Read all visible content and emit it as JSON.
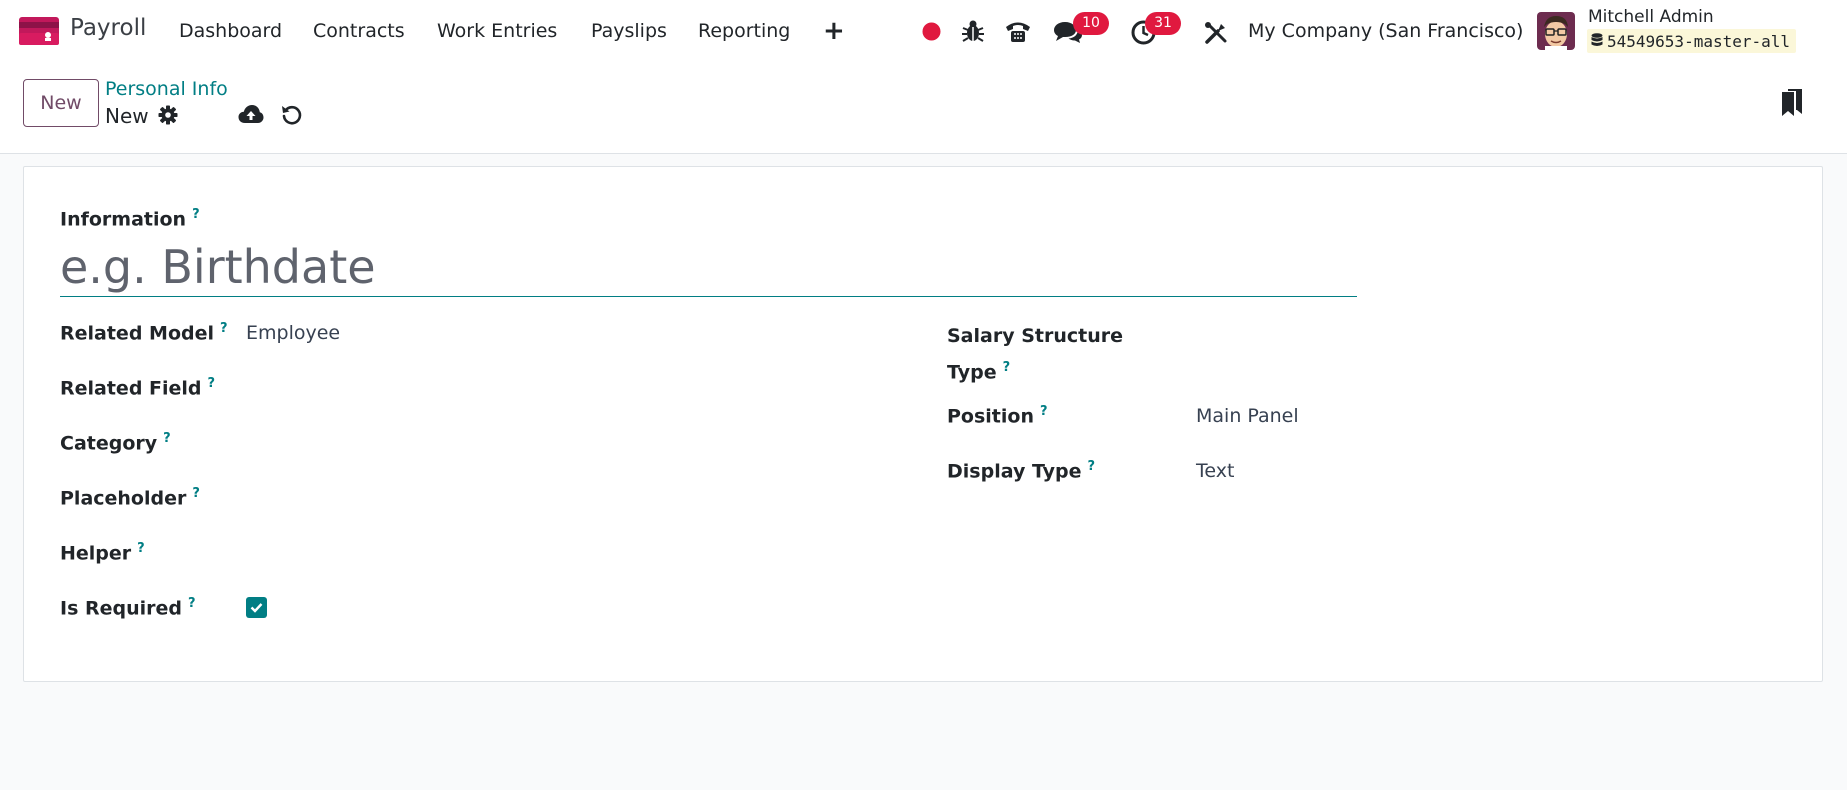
{
  "navbar": {
    "app_name": "Payroll",
    "menu": [
      "Dashboard",
      "Contracts",
      "Work Entries",
      "Payslips",
      "Reporting"
    ],
    "add_symbol": "+",
    "messages_count": "10",
    "activities_count": "31",
    "company": "My Company (San Francisco)",
    "user_name": "Mitchell Admin",
    "database": "54549653-master-all",
    "recording_color": "#e0193f"
  },
  "control_panel": {
    "new_button": "New",
    "breadcrumb_parent": "Personal Info",
    "breadcrumb_current": "New"
  },
  "form": {
    "information_label": "Information",
    "information_placeholder": "e.g. Birthdate",
    "help_mark": "?",
    "left_fields": [
      {
        "label": "Related Model",
        "value": "Employee"
      },
      {
        "label": "Related Field",
        "value": ""
      },
      {
        "label": "Category",
        "value": ""
      },
      {
        "label": "Placeholder",
        "value": ""
      },
      {
        "label": "Helper",
        "value": ""
      },
      {
        "label": "Is Required",
        "checked": true
      }
    ],
    "right_fields": [
      {
        "label_line1": "Salary Structure",
        "label_line2": "Type",
        "value": ""
      },
      {
        "label": "Position",
        "value": "Main Panel"
      },
      {
        "label": "Display Type",
        "value": "Text"
      }
    ]
  }
}
